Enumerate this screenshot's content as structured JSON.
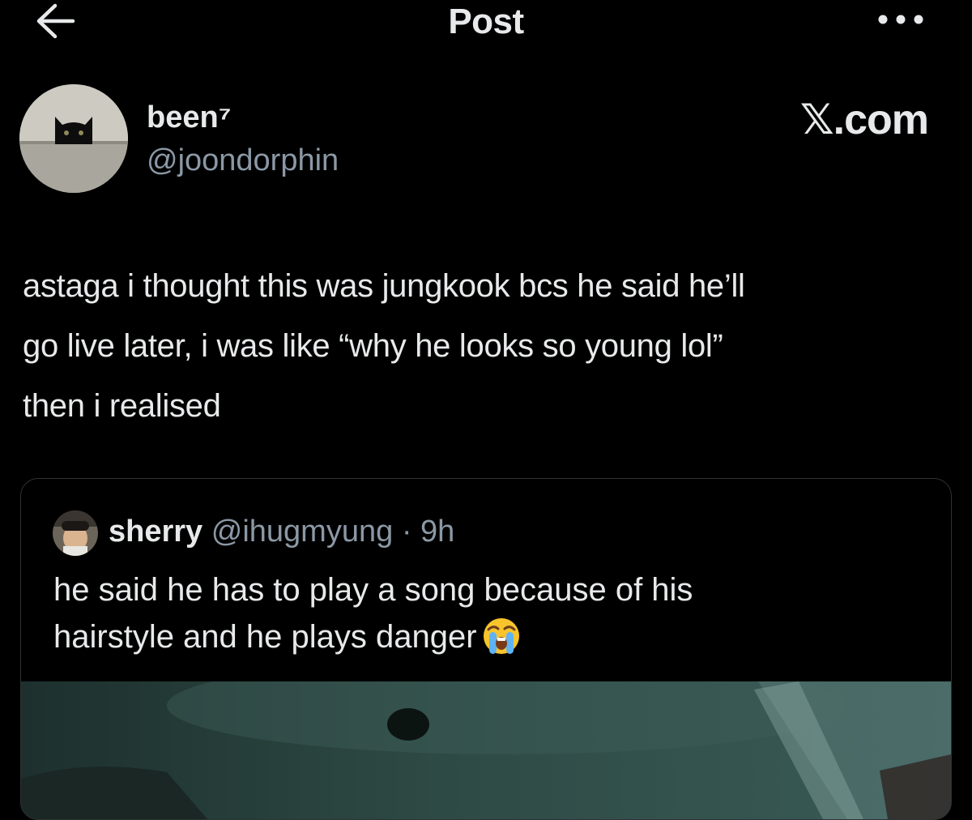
{
  "header": {
    "title": "Post",
    "back_icon": "arrow-left-icon",
    "more_icon": "more-horizontal-icon"
  },
  "author": {
    "display_name": "been⁷",
    "handle": "@joondorphin",
    "avatar_icon": "black-cat-avatar"
  },
  "brand": {
    "text": "𝕏.com"
  },
  "post": {
    "lines": [
      "astaga i thought this was jungkook bcs he said he’ll",
      "go live later, i was like “why he looks so young lol”",
      "then i realised"
    ]
  },
  "quote": {
    "display_name": "sherry",
    "handle": "@ihugmyung",
    "separator": "·",
    "time": "9h",
    "lines": [
      "he said he has to play a song because of his",
      "hairstyle and he plays danger"
    ],
    "emoji": "loudly-crying-face-emoji",
    "media": "video-thumbnail"
  },
  "colors": {
    "background": "#000000",
    "text": "#e7e9ea",
    "secondary": "#8b98a5",
    "border": "#2f3336"
  }
}
